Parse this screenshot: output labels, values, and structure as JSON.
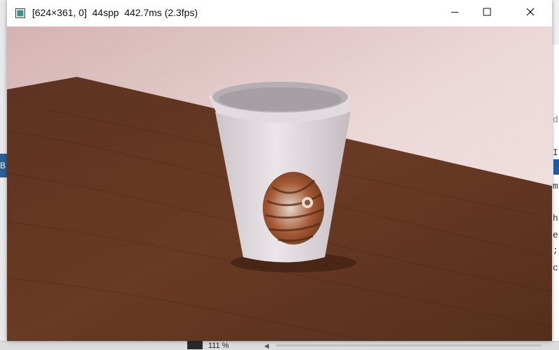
{
  "window": {
    "title": "[624×361, 0]  44spp  442.7ms (2.3fps)",
    "controls": {
      "minimize": "minimize",
      "maximize": "maximize",
      "close": "close"
    }
  },
  "scene": {
    "icons": [
      "app-window-icon",
      "minimize-icon",
      "maximize-icon",
      "close-icon"
    ]
  },
  "background_app": {
    "left_tab_text": "B",
    "right_chars": [
      "d",
      "I",
      "m",
      "h",
      "e",
      ";",
      "c"
    ],
    "zoom_text": "111 %"
  }
}
